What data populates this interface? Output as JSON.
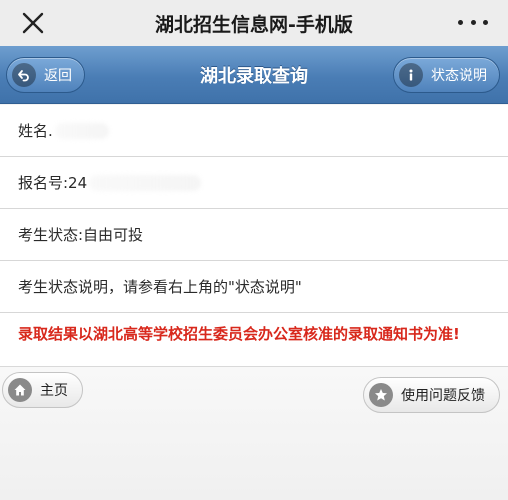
{
  "topbar": {
    "title": "湖北招生信息网-手机版"
  },
  "header": {
    "back_label": "返回",
    "page_title": "湖北录取查询",
    "status_label": "状态说明"
  },
  "rows": {
    "name_label": "姓名.",
    "reg_label": "报名号:24",
    "exam_status": "考生状态:自由可投",
    "status_desc": "考生状态说明，请参看右上角的\"状态说明\"",
    "notice": "录取结果以湖北高等学校招生委员会办公室核准的录取通知书为准!"
  },
  "footer": {
    "home_label": "主页",
    "feedback_label": "使用问题反馈"
  },
  "colors": {
    "header_blue": "#4a7db5",
    "notice_red": "#d8281c"
  }
}
